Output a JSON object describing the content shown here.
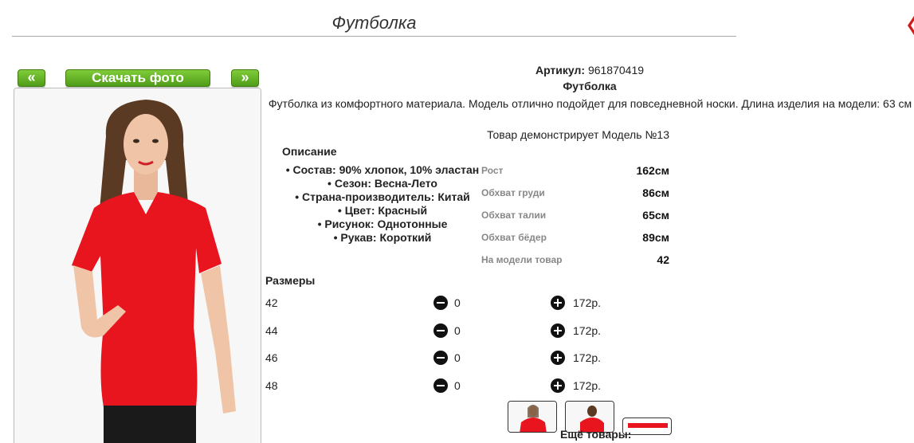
{
  "page": {
    "title": "Футболка"
  },
  "gallery": {
    "prev_label": "«",
    "download_label": "Скачать фото",
    "next_label": "»"
  },
  "product": {
    "article_label": "Артикул:",
    "article_value": "961870419",
    "name": "Футболка",
    "description": "Футболка из комфортного материала. Модель отлично подойдет для повседневной носки. Длина изделия на модели: 63 см",
    "model_line": "Товар демонстрирует Модель №13"
  },
  "specs": {
    "heading": "Описание",
    "items": [
      "Состав: 90% хлопок, 10% эластан",
      "Сезон: Весна-Лето",
      "Страна-производитель: Китай",
      "Цвет: Красный",
      "Рисунок: Однотонные",
      "Рукав: Короткий"
    ]
  },
  "measurements": [
    {
      "label": "Рост",
      "value": "162см"
    },
    {
      "label": "Обхват груди",
      "value": "86см"
    },
    {
      "label": "Обхват талии",
      "value": "65см"
    },
    {
      "label": "Обхват бёдер",
      "value": "89см"
    },
    {
      "label": "На модели товар",
      "value": "42"
    }
  ],
  "sizes": {
    "heading": "Размеры",
    "rows": [
      {
        "size": "42",
        "qty": "0",
        "price": "172р."
      },
      {
        "size": "44",
        "qty": "0",
        "price": "172р."
      },
      {
        "size": "46",
        "qty": "0",
        "price": "172р."
      },
      {
        "size": "48",
        "qty": "0",
        "price": "172р."
      }
    ]
  },
  "footer": {
    "more_products": "Ещё товары:"
  },
  "icons": {
    "minus": "minus-circle-icon",
    "plus": "plus-circle-icon"
  },
  "colors": {
    "accent_green": "#5fae22",
    "product_red": "#e8141e"
  }
}
